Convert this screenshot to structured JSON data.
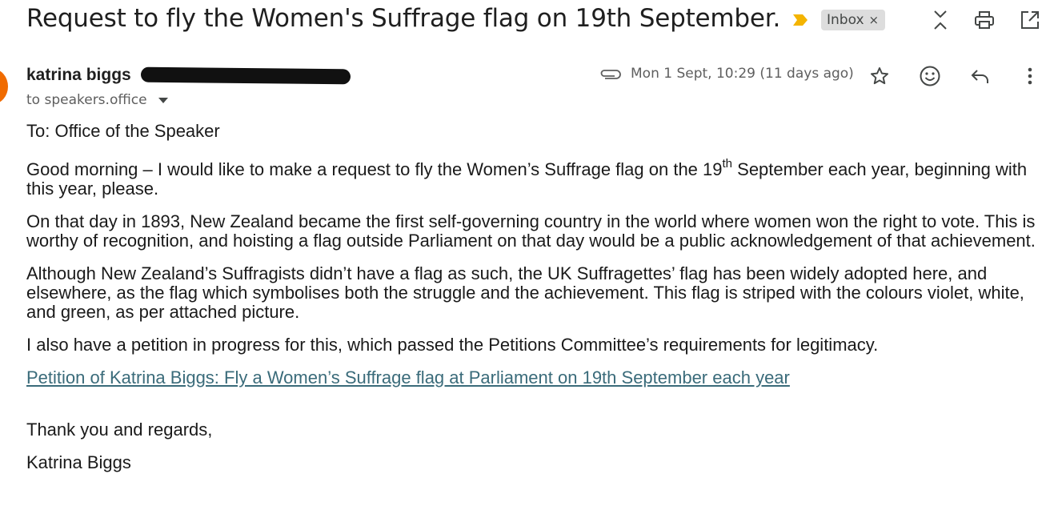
{
  "subject": "Request to fly the Women's Suffrage flag on 19th September.",
  "label": {
    "name": "Inbox",
    "close": "×"
  },
  "header_icons": [
    "expand-collapse-icon",
    "print-icon",
    "open-in-new-window-icon"
  ],
  "sender": {
    "name": "katrina biggs",
    "recipient": "to speakers.office",
    "avatar_color": "#f06b00"
  },
  "meta": {
    "timestamp": "Mon 1 Sept, 10:29 (11 days ago)"
  },
  "action_icons": [
    "star-icon",
    "emoji-reaction-icon",
    "reply-icon",
    "more-options-icon"
  ],
  "body": {
    "to_line": "To: Office of the Speaker",
    "p1_before": "Good morning – I would like to make a request to fly the Women’s Suffrage flag on the 19",
    "p1_sup": "th",
    "p1_after": " September each year, beginning with this year, please.",
    "p2": "On that day in 1893, New Zealand became the first self-governing country in the world where women won the right to vote. This is worthy of recognition, and hoisting a flag outside Parliament on that day would be a public acknowledgement of that achievement.",
    "p3": "Although New Zealand’s Suffragists didn’t have a flag as such, the UK Suffragettes’ flag has been widely adopted here, and elsewhere, as the flag which symbolises both the struggle and the achievement. This flag is striped with the colours violet, white, and green, as per attached picture.",
    "p4": "I also have a petition in progress for this, which passed the Petitions Committee’s requirements for legitimacy.",
    "link": "Petition of Katrina Biggs: Fly a Women’s Suffrage flag at Parliament on 19th September each year",
    "closing": "Thank you and regards,",
    "signature": "Katrina Biggs"
  },
  "colors": {
    "link": "#3a6b7a",
    "importance_marker": "#f4b400",
    "label_chip_bg": "#dddddd"
  }
}
